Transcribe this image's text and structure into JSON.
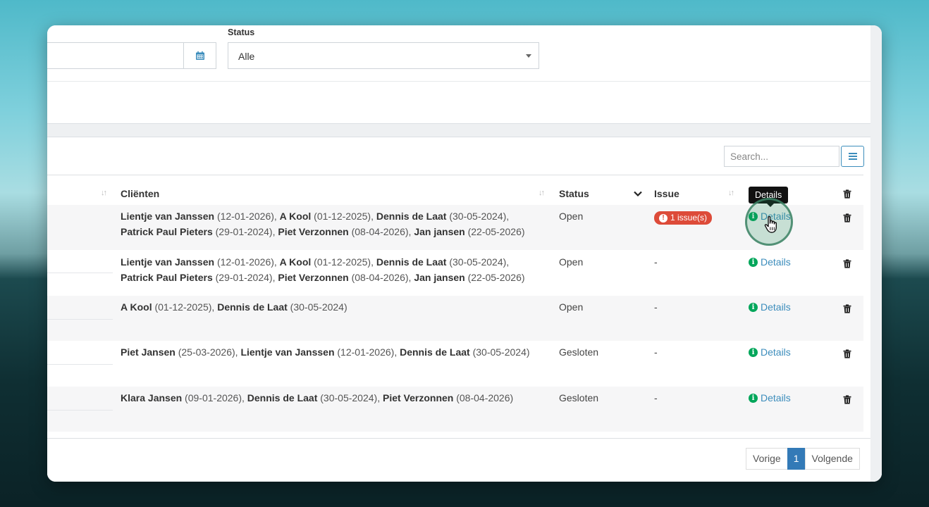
{
  "filters": {
    "status_label": "Status",
    "status_value": "Alle"
  },
  "table": {
    "search_placeholder": "Search...",
    "columns": {
      "clients": "Cliënten",
      "status": "Status",
      "issue": "Issue"
    },
    "tooltip": "Details",
    "details_label": "Details",
    "rows": [
      {
        "clients": [
          {
            "name": "Lientje van Janssen",
            "date": " (12-01-2026), "
          },
          {
            "name": "A Kool",
            "date": " (01-12-2025), "
          },
          {
            "name": "Dennis de Laat",
            "date": " (30-05-2024), "
          },
          {
            "name": "Patrick Paul Pieters",
            "date": " (29-01-2024), "
          },
          {
            "name": "Piet Verzonnen",
            "date": " (08-04-2026), "
          },
          {
            "name": "Jan jansen",
            "date": " (22-05-2026)"
          }
        ],
        "status": "Open",
        "issue": "1 issue(s)",
        "has_issue": true
      },
      {
        "clients": [
          {
            "name": "Lientje van Janssen",
            "date": " (12-01-2026), "
          },
          {
            "name": "A Kool",
            "date": " (01-12-2025), "
          },
          {
            "name": "Dennis de Laat",
            "date": " (30-05-2024), "
          },
          {
            "name": "Patrick Paul Pieters",
            "date": " (29-01-2024), "
          },
          {
            "name": "Piet Verzonnen",
            "date": " (08-04-2026), "
          },
          {
            "name": "Jan jansen",
            "date": " (22-05-2026)"
          }
        ],
        "status": "Open",
        "issue": "-",
        "has_issue": false
      },
      {
        "clients": [
          {
            "name": "A Kool",
            "date": " (01-12-2025), "
          },
          {
            "name": "Dennis de Laat",
            "date": " (30-05-2024)"
          }
        ],
        "status": "Open",
        "issue": "-",
        "has_issue": false
      },
      {
        "clients": [
          {
            "name": "Piet Jansen",
            "date": " (25-03-2026), "
          },
          {
            "name": "Lientje van Janssen",
            "date": " (12-01-2026), "
          },
          {
            "name": "Dennis de Laat",
            "date": " (30-05-2024)"
          }
        ],
        "status": "Gesloten",
        "issue": "-",
        "has_issue": false
      },
      {
        "clients": [
          {
            "name": "Klara Jansen",
            "date": " (09-01-2026), "
          },
          {
            "name": "Dennis de Laat",
            "date": " (30-05-2024), "
          },
          {
            "name": "Piet Verzonnen",
            "date": " (08-04-2026)"
          }
        ],
        "status": "Gesloten",
        "issue": "-",
        "has_issue": false
      }
    ]
  },
  "pagination": {
    "prev": "Vorige",
    "current": "1",
    "next": "Volgende"
  },
  "colors": {
    "accent": "#3c8dbc",
    "danger": "#dd4b39",
    "info": "#00a65a"
  }
}
